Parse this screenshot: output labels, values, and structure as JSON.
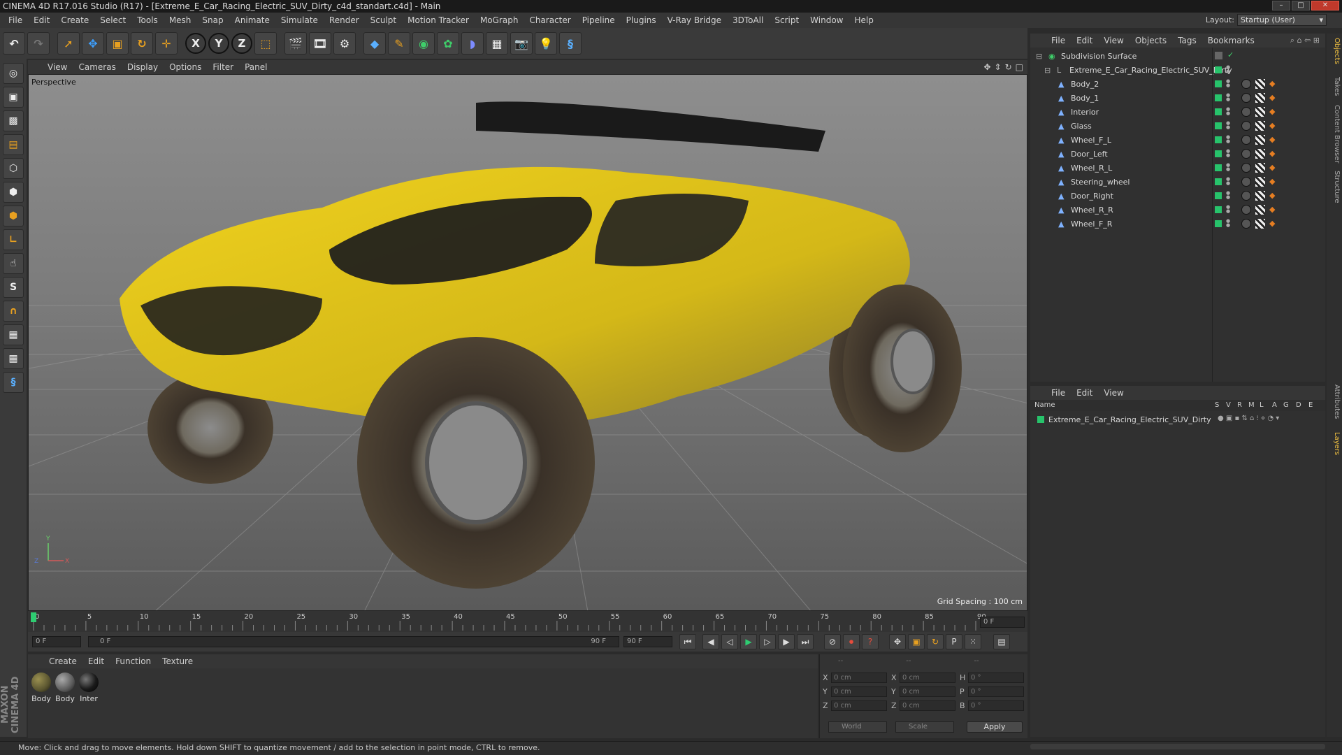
{
  "window": {
    "title": "CINEMA 4D R17.016 Studio (R17) - [Extreme_E_Car_Racing_Electric_SUV_Dirty_c4d_standart.c4d] - Main"
  },
  "menubar": {
    "items": [
      "File",
      "Edit",
      "Create",
      "Select",
      "Tools",
      "Mesh",
      "Snap",
      "Animate",
      "Simulate",
      "Render",
      "Sculpt",
      "Motion Tracker",
      "MoGraph",
      "Character",
      "Pipeline",
      "Plugins",
      "V-Ray Bridge",
      "3DToAll",
      "Script",
      "Window",
      "Help"
    ],
    "layout_label": "Layout:",
    "layout_value": "Startup (User)"
  },
  "toolbar": {
    "axis": [
      "X",
      "Y",
      "Z"
    ]
  },
  "viewport": {
    "menu": [
      "View",
      "Cameras",
      "Display",
      "Options",
      "Filter",
      "Panel"
    ],
    "label": "Perspective",
    "grid_spacing": "Grid Spacing : 100 cm"
  },
  "timeline": {
    "ticks": [
      "0",
      "5",
      "10",
      "15",
      "20",
      "25",
      "30",
      "35",
      "40",
      "45",
      "50",
      "55",
      "60",
      "65",
      "70",
      "75",
      "80",
      "85",
      "90"
    ],
    "current_frame_field": "0 F",
    "start_field": "0 F",
    "range_start": "0 F",
    "range_end": "90 F",
    "end_field": "90 F"
  },
  "material_manager": {
    "menu": [
      "Create",
      "Edit",
      "Function",
      "Texture"
    ],
    "materials": [
      {
        "name": "Body",
        "color": "#5a5530"
      },
      {
        "name": "Body",
        "color": "#5b5b5b"
      },
      {
        "name": "Inter",
        "color": "#1a1a1a"
      }
    ]
  },
  "coordinates": {
    "header": [
      "--",
      "--",
      "--"
    ],
    "rows": [
      {
        "a": "X",
        "v1": "0 cm",
        "b": "X",
        "v2": "0 cm",
        "c": "H",
        "v3": "0 °"
      },
      {
        "a": "Y",
        "v1": "0 cm",
        "b": "Y",
        "v2": "0 cm",
        "c": "P",
        "v3": "0 °"
      },
      {
        "a": "Z",
        "v1": "0 cm",
        "b": "Z",
        "v2": "0 cm",
        "c": "B",
        "v3": "0 °"
      }
    ],
    "mode1": "World",
    "mode2": "Scale",
    "apply": "Apply"
  },
  "status": {
    "text": "Move: Click and drag to move elements. Hold down SHIFT to quantize movement / add to the selection in point mode, CTRL to remove."
  },
  "object_manager": {
    "menu": [
      "File",
      "Edit",
      "View",
      "Objects",
      "Tags",
      "Bookmarks"
    ],
    "root": "Subdivision Surface",
    "group": "Extreme_E_Car_Racing_Electric_SUV_Dirty",
    "objects": [
      "Body_2",
      "Body_1",
      "Interior",
      "Glass",
      "Wheel_F_L",
      "Door_Left",
      "Wheel_R_L",
      "Steering_wheel",
      "Door_Right",
      "Wheel_R_R",
      "Wheel_F_R"
    ]
  },
  "layer_manager": {
    "menu": [
      "File",
      "Edit",
      "View"
    ],
    "columns": [
      "Name",
      "S",
      "V",
      "R",
      "M",
      "L",
      "A",
      "G",
      "D",
      "E"
    ],
    "layers": [
      "Extreme_E_Car_Racing_Electric_SUV_Dirty"
    ]
  },
  "right_tabs": [
    "Objects",
    "Takes",
    "Content Browser",
    "Structure",
    "Attributes",
    "Layers"
  ],
  "branding": "MAXON CINEMA 4D",
  "colors": {
    "layer_green": "#27c36b",
    "car_yellow": "#e0c21a"
  }
}
